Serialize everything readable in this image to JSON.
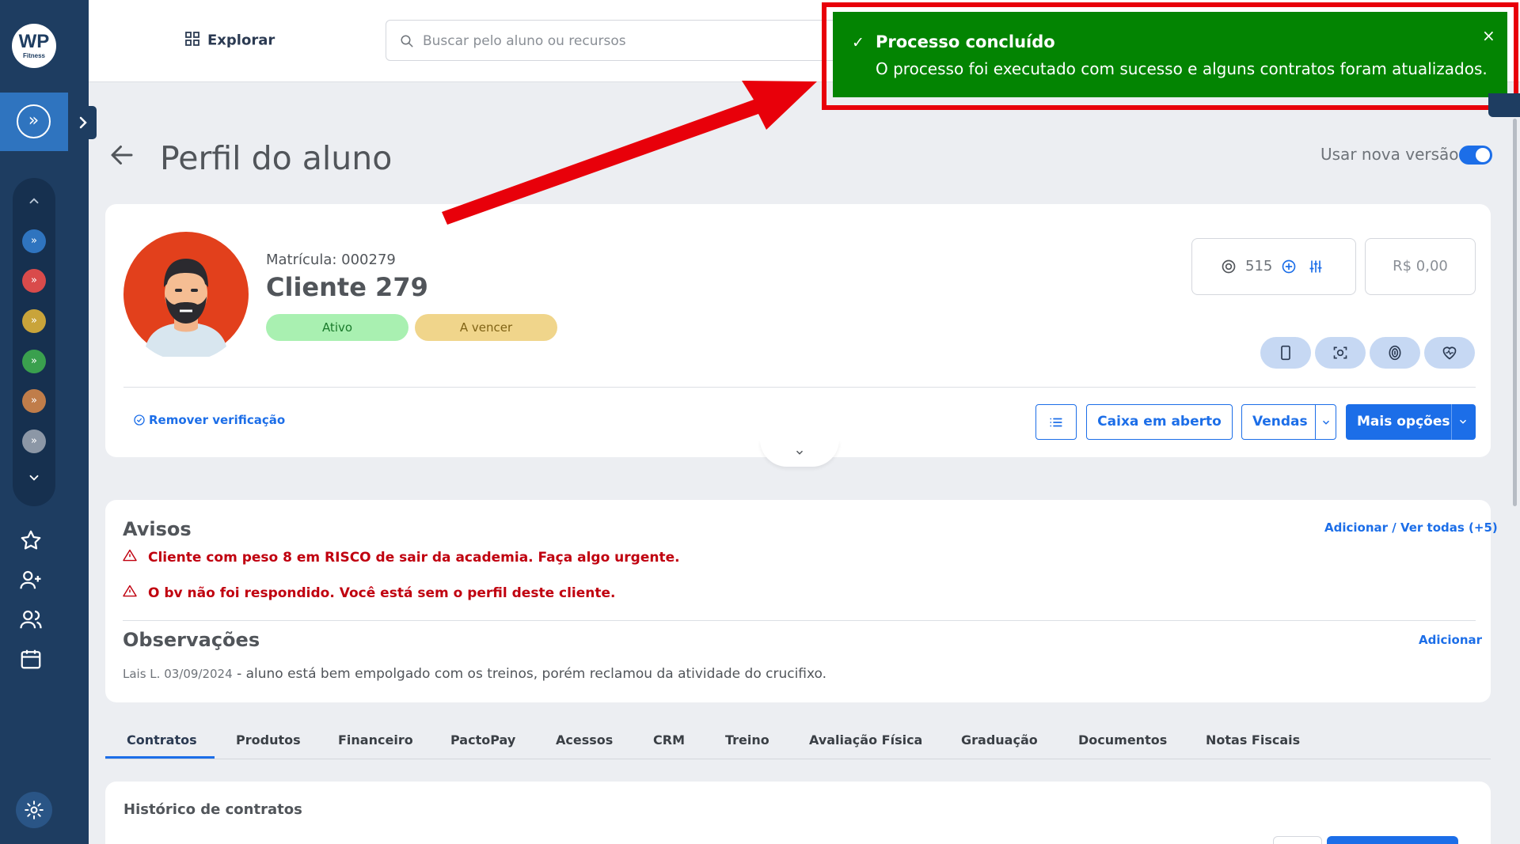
{
  "sidebar": {
    "logo_big": "WP",
    "logo_small": "Fitness",
    "units": [
      "#2f74bf",
      "#d94b4b",
      "#c9a43a",
      "#3aa04e",
      "#c07d4a",
      "#8c97a6"
    ]
  },
  "topbar": {
    "explore_label": "Explorar",
    "search_placeholder": "Buscar pelo aluno ou recursos"
  },
  "toast": {
    "title": "Processo concluído",
    "message": "O processo foi executado com sucesso e alguns contratos foram atualizados.",
    "close": "×",
    "check": "✓",
    "color": "#038402",
    "highlight_color": "#e8000a"
  },
  "page": {
    "title": "Perfil do aluno",
    "new_version_label": "Usar nova versão",
    "new_version_on": true
  },
  "profile": {
    "matricula": "Matrícula: 000279",
    "name": "Cliente 279",
    "status_badges": [
      "Ativo",
      "A vencer"
    ],
    "points": "515",
    "balance": "R$ 0,00",
    "remove_verification": "Remover verificação",
    "buttons": {
      "cash": "Caixa em aberto",
      "sales": "Vendas",
      "more": "Mais opções"
    }
  },
  "avisos": {
    "title": "Avisos",
    "link": "Adicionar / Ver todas (+5)",
    "items": [
      "Cliente com peso 8 em RISCO de sair da academia. Faça algo urgente.",
      "O bv não foi respondido. Você está sem o perfil deste cliente."
    ]
  },
  "observacoes": {
    "title": "Observações",
    "link": "Adicionar",
    "author": "Lais L. 03/09/2024",
    "text": "- aluno está bem empolgado com os treinos, porém reclamou da atividade do crucifixo."
  },
  "tabs": [
    "Contratos",
    "Produtos",
    "Financeiro",
    "PactoPay",
    "Acessos",
    "CRM",
    "Treino",
    "Avaliação Física",
    "Graduação",
    "Documentos",
    "Notas Fiscais"
  ],
  "history": {
    "title": "Histórico de contratos"
  }
}
